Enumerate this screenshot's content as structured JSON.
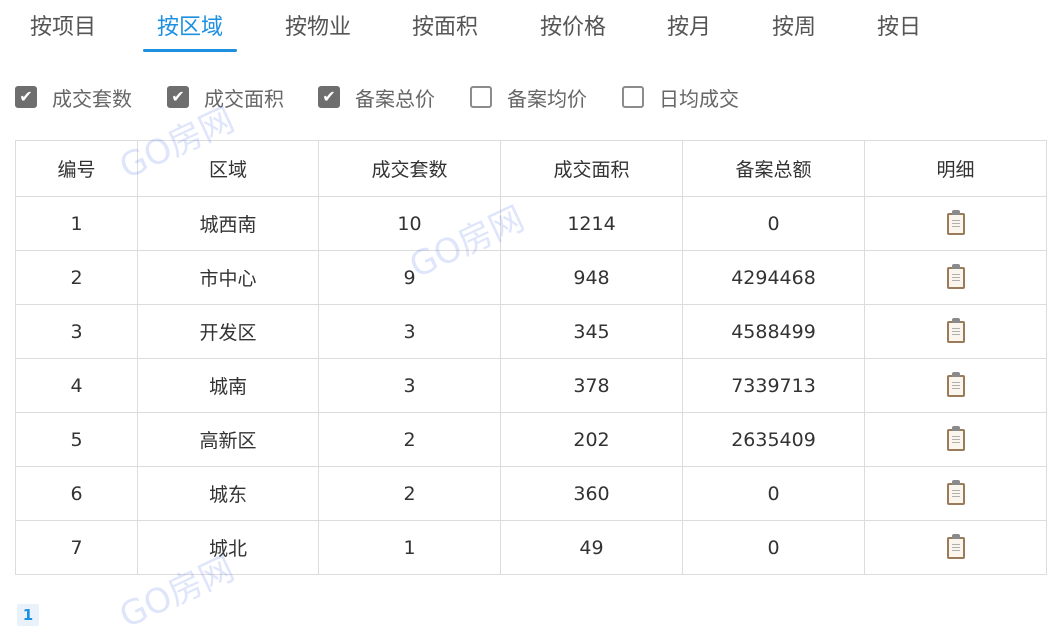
{
  "tabs": [
    {
      "label": "按项目",
      "active": false
    },
    {
      "label": "按区域",
      "active": true
    },
    {
      "label": "按物业",
      "active": false
    },
    {
      "label": "按面积",
      "active": false
    },
    {
      "label": "按价格",
      "active": false
    },
    {
      "label": "按月",
      "active": false
    },
    {
      "label": "按周",
      "active": false
    },
    {
      "label": "按日",
      "active": false
    }
  ],
  "filters": [
    {
      "label": "成交套数",
      "checked": true
    },
    {
      "label": "成交面积",
      "checked": true
    },
    {
      "label": "备案总价",
      "checked": true
    },
    {
      "label": "备案均价",
      "checked": false
    },
    {
      "label": "日均成交",
      "checked": false
    }
  ],
  "table": {
    "headers": [
      "编号",
      "区域",
      "成交套数",
      "成交面积",
      "备案总额",
      "明细"
    ],
    "rows": [
      [
        "1",
        "城西南",
        "10",
        "1214",
        "0"
      ],
      [
        "2",
        "市中心",
        "9",
        "948",
        "4294468"
      ],
      [
        "3",
        "开发区",
        "3",
        "345",
        "4588499"
      ],
      [
        "4",
        "城南",
        "3",
        "378",
        "7339713"
      ],
      [
        "5",
        "高新区",
        "2",
        "202",
        "2635409"
      ],
      [
        "6",
        "城东",
        "2",
        "360",
        "0"
      ],
      [
        "7",
        "城北",
        "1",
        "49",
        "0"
      ]
    ],
    "detail_icon": "clipboard-icon"
  },
  "pagination": {
    "current": "1"
  },
  "watermark": "GO房网",
  "colors": {
    "accent": "#1e90e0",
    "checkbox": "#6e6e6e",
    "border": "#dcdcdc"
  }
}
